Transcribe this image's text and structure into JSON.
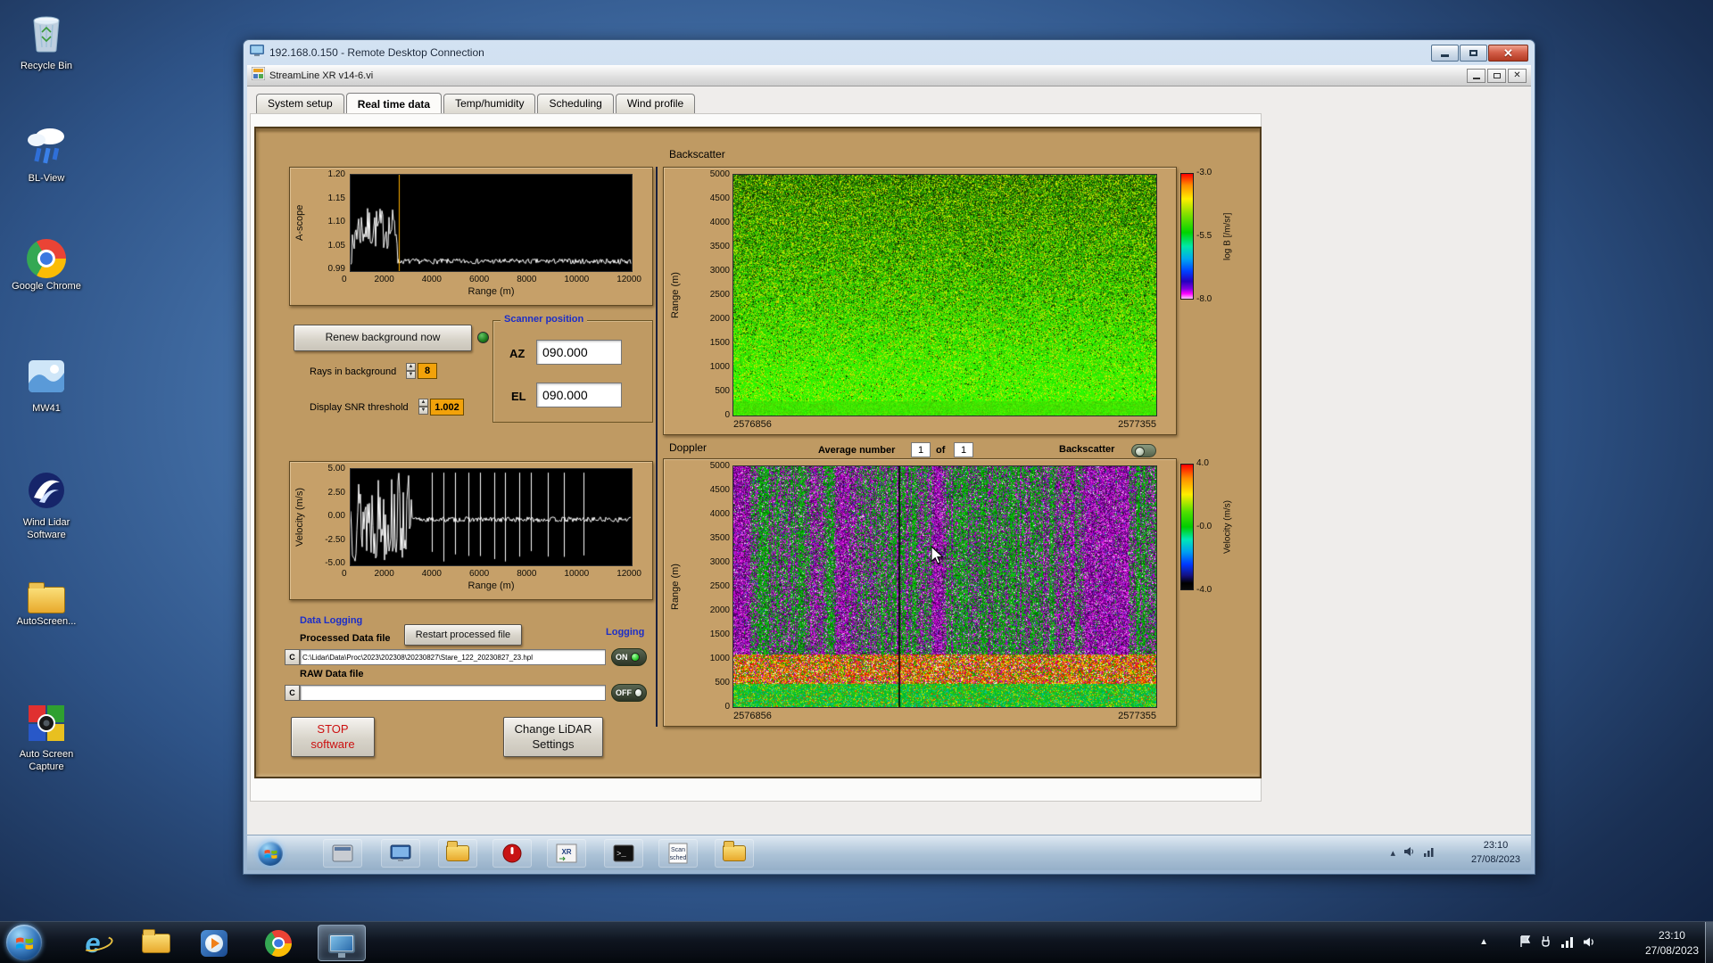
{
  "desktop": {
    "icons": [
      {
        "id": "recycle-bin",
        "label": "Recycle Bin"
      },
      {
        "id": "bl-view",
        "label": "BL-View"
      },
      {
        "id": "google-chrome",
        "label": "Google Chrome"
      },
      {
        "id": "mw41",
        "label": "MW41"
      },
      {
        "id": "wind-lidar-software",
        "label": "Wind Lidar Software"
      },
      {
        "id": "autoscreen",
        "label": "AutoScreen..."
      },
      {
        "id": "auto-screen-capture",
        "label": "Auto Screen Capture"
      }
    ]
  },
  "rdp": {
    "title": "192.168.0.150 - Remote Desktop Connection",
    "taskbar": {
      "icons": [
        "start-orb",
        "app-window",
        "display-settings",
        "folder-screens",
        "stop-power",
        "xr-tool",
        "console",
        "scan-scheduler",
        "folder-files"
      ],
      "xr_icon_label": "XR",
      "scan_icon_line1": "Scan",
      "scan_icon_line2": "sched",
      "clock_time": "23:10",
      "clock_date": "27/08/2023"
    }
  },
  "app": {
    "title": "StreamLine XR v14-6.vi",
    "tabs": [
      {
        "label": "System setup"
      },
      {
        "label": "Real time data"
      },
      {
        "label": "Temp/humidity"
      },
      {
        "label": "Scheduling"
      },
      {
        "label": "Wind profile"
      }
    ],
    "active_tab": "Real time data",
    "section_backscatter": "Backscatter",
    "section_doppler": "Doppler",
    "renew_button": "Renew background now",
    "rays_label": "Rays in background",
    "rays_value": "8",
    "snr_label": "Display SNR threshold",
    "snr_value": "1.002",
    "scanner": {
      "title": "Scanner position",
      "az_label": "AZ",
      "az_value": "090.000",
      "el_label": "EL",
      "el_value": "090.000"
    },
    "average_label": "Average number",
    "average_value": "1",
    "of_label": "of",
    "of_value": "1",
    "backscatter_toggle_label": "Backscatter",
    "logging": {
      "section": "Data Logging",
      "processed_label": "Processed Data file",
      "restart_button": "Restart processed file",
      "logging_label": "Logging",
      "drive": "C",
      "processed_path": "C:\\Lidar\\Data\\Proc\\2023\\202308\\20230827\\Stare_122_20230827_23.hpl",
      "on_label": "ON",
      "raw_label": "RAW Data file",
      "raw_path": "",
      "off_label": "OFF"
    },
    "stop_button_line1": "STOP",
    "stop_button_line2": "software",
    "settings_button_line1": "Change LiDAR",
    "settings_button_line2": "Settings"
  },
  "host_taskbar": {
    "icons": [
      "start-orb",
      "internet-explorer",
      "windows-explorer",
      "windows-media-player",
      "google-chrome",
      "remote-desktop"
    ],
    "tray_icons": [
      "action-center-flag",
      "power",
      "network",
      "volume"
    ],
    "clock_time": "23:10",
    "clock_date": "27/08/2023"
  },
  "chart_data": [
    {
      "id": "ascope",
      "type": "line",
      "ylabel": "A-scope",
      "xlabel": "Range (m)",
      "yticks": [
        "1.20",
        "1.15",
        "1.10",
        "1.05",
        "0.99"
      ],
      "xticks": [
        "0",
        "2000",
        "4000",
        "6000",
        "8000",
        "10000",
        "12000"
      ],
      "ylim": [
        0.99,
        1.2
      ],
      "xlim": [
        0,
        12000
      ],
      "cursor_x_fraction": 0.17,
      "pattern": "noisy cluster 1.04-1.13 below 2000 m decaying to ~1.005 baseline; orange cursor line"
    },
    {
      "id": "velocity",
      "type": "line",
      "ylabel": "Velocity (m/s)",
      "xlabel": "Range (m)",
      "yticks": [
        "5.00",
        "2.50",
        "0.00",
        "-2.50",
        "-5.00"
      ],
      "xticks": [
        "0",
        "2000",
        "4000",
        "6000",
        "8000",
        "10000",
        "12000"
      ],
      "ylim": [
        -5,
        5
      ],
      "xlim": [
        0,
        12000
      ],
      "spike_fractions": [
        0.29,
        0.33,
        0.37,
        0.42,
        0.46,
        0.51,
        0.55,
        0.6,
        0.64,
        0.7,
        0.76,
        0.83
      ],
      "pattern": "dense full-scale noise below ~2600 m then near-zero baseline with sparse vertical spikes"
    },
    {
      "id": "backscatter",
      "type": "heatmap",
      "title": "Backscatter",
      "ylabel": "Range (m)",
      "yticks": [
        "5000",
        "4500",
        "4000",
        "3500",
        "3000",
        "2500",
        "2000",
        "1500",
        "1000",
        "500",
        "0"
      ],
      "x_start": "2576856",
      "x_end": "2577355",
      "colorbar": {
        "label": "log B [/m/sr]",
        "ticks": [
          "-3.0",
          "-5.5",
          "-8.0"
        ],
        "min": -8.0,
        "max": -3.0
      },
      "pattern": "green/yellow speckle noise, darker speckle aloft, solid bright green below ~300 m"
    },
    {
      "id": "doppler",
      "type": "heatmap",
      "title": "Doppler",
      "ylabel": "Range (m)",
      "yticks": [
        "5000",
        "4500",
        "4000",
        "3500",
        "3000",
        "2500",
        "2000",
        "1500",
        "1000",
        "500",
        "0"
      ],
      "x_start": "2576856",
      "x_end": "2577355",
      "colorbar": {
        "label": "Velocity (m/s)",
        "ticks": [
          "4.0",
          "-0.0",
          "-4.0"
        ],
        "min": -4.0,
        "max": 4.0
      },
      "gap_fraction": 0.39,
      "pattern": "magenta noise with green vertical streaks above ~1100 m; red/yellow then green/cyan layers below"
    }
  ]
}
